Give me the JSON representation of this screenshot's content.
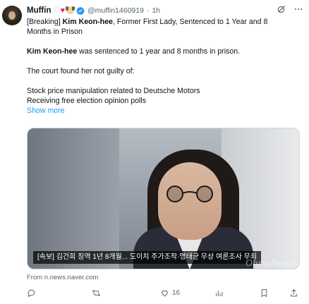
{
  "author": {
    "name": "Muffin",
    "handle": "@muffin1460919",
    "separator": "·",
    "time": "1h"
  },
  "tweet": {
    "line1_prefix": "[Breaking] ",
    "line1_bold": "Kim Keon-hee",
    "line1_suffix": ", Former First Lady, Sentenced to 1 Year and 8",
    "line2": "Months in Prison",
    "line3_bold": "Kim Keon-hee",
    "line3_suffix": " was sentenced to 1 year and 8 months in prison.",
    "line4": "The court   found her not guilty of:",
    "line5": "Stock price manipulation related to Deutsche Motors",
    "line6": "Receiving  free election opinion polls",
    "show_more": "Show more"
  },
  "media": {
    "caption": "[속보] 김건희 징역 1년 8개월... 도이치 주가조작·명태균 무상 여론조사 무죄",
    "watermark": "OhmyNews"
  },
  "source": "From n.news.naver.com",
  "stats": {
    "likes": "16"
  },
  "colors": {
    "accent": "#1d9bf0",
    "muted": "#536471",
    "text": "#0f1419"
  }
}
